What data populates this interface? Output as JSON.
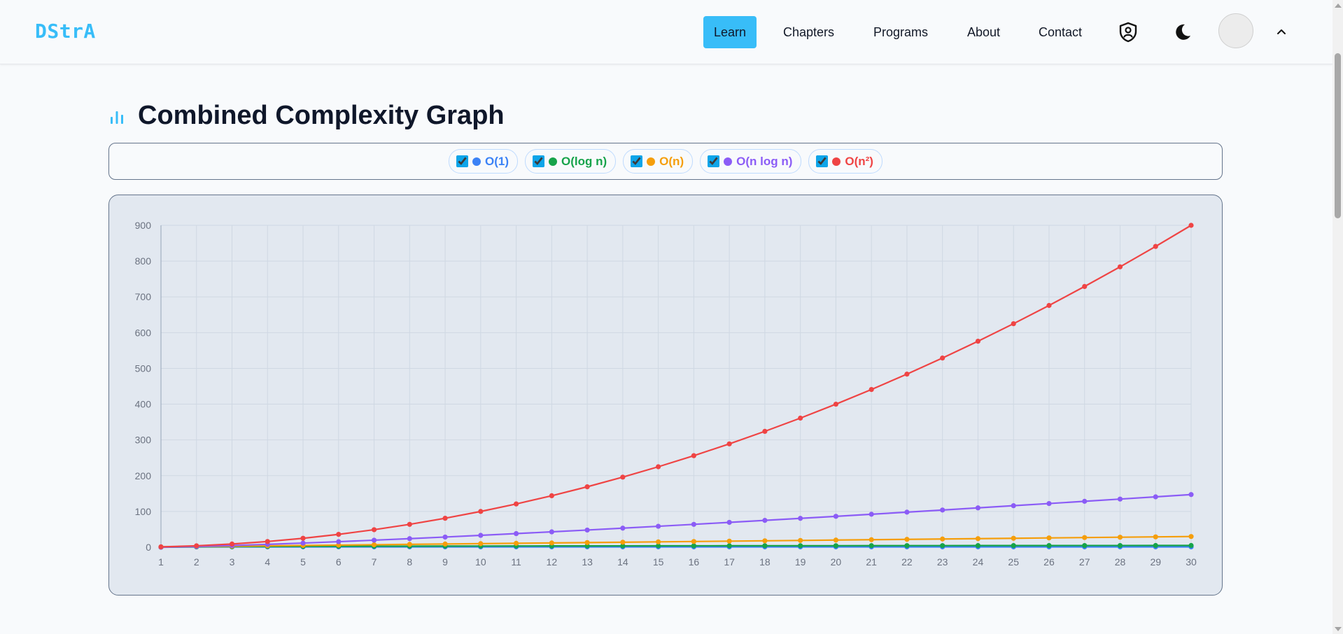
{
  "navbar": {
    "brand": "DStrA",
    "links": [
      {
        "label": "Learn",
        "active": true
      },
      {
        "label": "Chapters",
        "active": false
      },
      {
        "label": "Programs",
        "active": false
      },
      {
        "label": "About",
        "active": false
      },
      {
        "label": "Contact",
        "active": false
      }
    ],
    "icons": [
      "shield-user-icon",
      "moon-icon",
      "avatar",
      "chevron-up-icon"
    ]
  },
  "page": {
    "title": "Combined Complexity Graph",
    "title_icon": "bar-chart-icon",
    "accent_color": "#38bdf8"
  },
  "toggles": [
    {
      "label": "O(1)",
      "checked": true,
      "color": "#3b82f6"
    },
    {
      "label": "O(log n)",
      "checked": true,
      "color": "#16a34a"
    },
    {
      "label": "O(n)",
      "checked": true,
      "color": "#f59e0b"
    },
    {
      "label": "O(n log n)",
      "checked": true,
      "color": "#8b5cf6"
    },
    {
      "label": "O(n²)",
      "checked": true,
      "color": "#ef4444"
    }
  ],
  "chart_data": {
    "type": "line",
    "x": [
      1,
      2,
      3,
      4,
      5,
      6,
      7,
      8,
      9,
      10,
      11,
      12,
      13,
      14,
      15,
      16,
      17,
      18,
      19,
      20,
      21,
      22,
      23,
      24,
      25,
      26,
      27,
      28,
      29,
      30
    ],
    "yticks": [
      0,
      100,
      200,
      300,
      400,
      500,
      600,
      700,
      800,
      900
    ],
    "ylim": [
      0,
      900
    ],
    "grid": true,
    "legend": "none",
    "series": [
      {
        "name": "O(1)",
        "color": "#3b82f6",
        "values": [
          1,
          1,
          1,
          1,
          1,
          1,
          1,
          1,
          1,
          1,
          1,
          1,
          1,
          1,
          1,
          1,
          1,
          1,
          1,
          1,
          1,
          1,
          1,
          1,
          1,
          1,
          1,
          1,
          1,
          1
        ]
      },
      {
        "name": "O(log n)",
        "color": "#16a34a",
        "values": [
          0,
          1,
          1.6,
          2,
          2.3,
          2.6,
          2.8,
          3,
          3.2,
          3.3,
          3.5,
          3.6,
          3.7,
          3.8,
          3.9,
          4,
          4.1,
          4.2,
          4.2,
          4.3,
          4.4,
          4.5,
          4.5,
          4.6,
          4.6,
          4.7,
          4.8,
          4.8,
          4.9,
          4.9
        ]
      },
      {
        "name": "O(n)",
        "color": "#f59e0b",
        "values": [
          1,
          2,
          3,
          4,
          5,
          6,
          7,
          8,
          9,
          10,
          11,
          12,
          13,
          14,
          15,
          16,
          17,
          18,
          19,
          20,
          21,
          22,
          23,
          24,
          25,
          26,
          27,
          28,
          29,
          30
        ]
      },
      {
        "name": "O(n log n)",
        "color": "#8b5cf6",
        "values": [
          0,
          2,
          4.8,
          8,
          11.6,
          15.5,
          19.7,
          24,
          28.5,
          33.2,
          38.1,
          43,
          48.1,
          53.3,
          58.6,
          64,
          69.5,
          75.1,
          80.7,
          86.4,
          92.2,
          98.1,
          104,
          110,
          116.1,
          122.2,
          128.4,
          134.6,
          140.9,
          147.2
        ]
      },
      {
        "name": "O(n²)",
        "color": "#ef4444",
        "values": [
          1,
          4,
          9,
          16,
          25,
          36,
          49,
          64,
          81,
          100,
          121,
          144,
          169,
          196,
          225,
          256,
          289,
          324,
          361,
          400,
          441,
          484,
          529,
          576,
          625,
          676,
          729,
          784,
          841,
          900
        ]
      }
    ]
  }
}
